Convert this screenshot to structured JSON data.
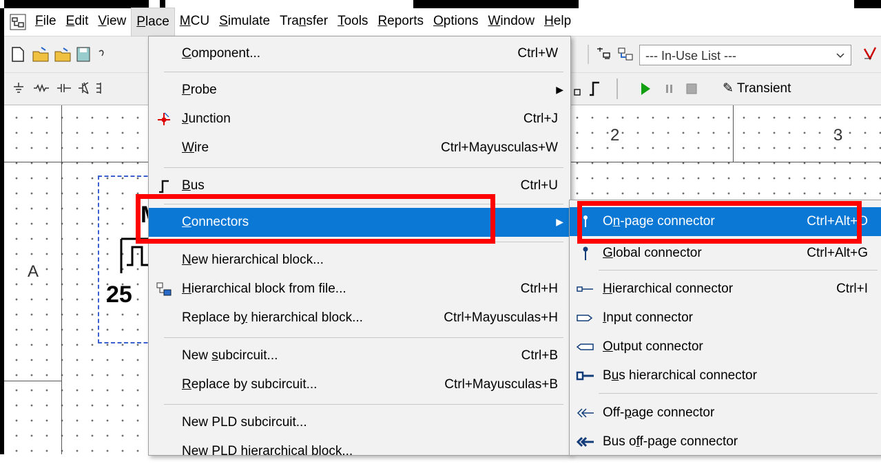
{
  "menubar": {
    "items": [
      {
        "id": "file",
        "text": "File",
        "mn": "F",
        "rest": "ile"
      },
      {
        "id": "edit",
        "text": "Edit",
        "mn": "E",
        "rest": "dit"
      },
      {
        "id": "view",
        "text": "View",
        "mn": "V",
        "rest": "iew"
      },
      {
        "id": "place",
        "text": "Place",
        "mn": "P",
        "rest": "lace",
        "active": true
      },
      {
        "id": "mcu",
        "text": "MCU",
        "mn": "M",
        "rest": "CU"
      },
      {
        "id": "simulate",
        "text": "Simulate",
        "mn": "S",
        "rest": "imulate"
      },
      {
        "id": "transfer",
        "text": "Transfer",
        "pre": "Tra",
        "mn": "n",
        "rest": "sfer"
      },
      {
        "id": "tools",
        "text": "Tools",
        "mn": "T",
        "rest": "ools"
      },
      {
        "id": "reports",
        "text": "Reports",
        "mn": "R",
        "rest": "eports"
      },
      {
        "id": "options",
        "text": "Options",
        "mn": "O",
        "rest": "ptions"
      },
      {
        "id": "window",
        "text": "Window",
        "mn": "W",
        "rest": "indow"
      },
      {
        "id": "help",
        "text": "Help",
        "mn": "H",
        "rest": "elp"
      }
    ]
  },
  "toolbar": {
    "inuse_list": "--- In-Use List ---",
    "transient": "Transient"
  },
  "canvas": {
    "col2": "2",
    "col3": "3",
    "rowA": "A",
    "partial_label_m": "M",
    "partial_value": "25"
  },
  "place_menu": {
    "component": {
      "pre": "",
      "mn": "C",
      "rest": "omponent...",
      "shortcut": "Ctrl+W"
    },
    "probe": {
      "pre": "",
      "mn": "P",
      "rest": "robe"
    },
    "junction": {
      "pre": "",
      "mn": "J",
      "rest": "unction",
      "shortcut": "Ctrl+J"
    },
    "wire": {
      "pre": "",
      "mn": "W",
      "rest": "ire",
      "shortcut": "Ctrl+Mayusculas+W"
    },
    "bus": {
      "pre": "",
      "mn": "B",
      "rest": "us",
      "shortcut": "Ctrl+U"
    },
    "connectors": {
      "pre": "",
      "mn": "C",
      "rest": "onnectors"
    },
    "new_hier_block": {
      "pre": "",
      "mn": "N",
      "rest": "ew hierarchical block..."
    },
    "hier_from_file": {
      "pre": "",
      "mn": "H",
      "rest": "ierarchical block from file...",
      "shortcut": "Ctrl+H"
    },
    "replace_hier": {
      "pre": "Replace b",
      "mn": "y",
      "rest": " hierarchical block...",
      "shortcut": "Ctrl+Mayusculas+H"
    },
    "new_subcircuit": {
      "pre": "New ",
      "mn": "s",
      "rest": "ubcircuit...",
      "shortcut": "Ctrl+B"
    },
    "replace_sub": {
      "pre": "",
      "mn": "R",
      "rest": "eplace by subcircuit...",
      "shortcut": "Ctrl+Mayusculas+B"
    },
    "new_pld_sub": {
      "pre": "New PLD subcircuit...",
      "mn": "",
      "rest": ""
    },
    "new_pld_hier": {
      "pre": "New PLD hierarchical block...",
      "mn": "",
      "rest": ""
    }
  },
  "connectors_menu": {
    "on_page": {
      "pre": "O",
      "mn": "n",
      "rest": "-page connector",
      "shortcut": "Ctrl+Alt+O"
    },
    "global": {
      "pre": "",
      "mn": "G",
      "rest": "lobal connector",
      "shortcut": "Ctrl+Alt+G"
    },
    "hierarchical": {
      "pre": "",
      "mn": "H",
      "rest": "ierarchical connector",
      "shortcut": "Ctrl+I"
    },
    "input": {
      "pre": "",
      "mn": "I",
      "rest": "nput connector"
    },
    "output": {
      "pre": "",
      "mn": "O",
      "rest": "utput connector"
    },
    "bus_hier": {
      "pre": "B",
      "mn": "u",
      "rest": "s hierarchical connector"
    },
    "off_page": {
      "pre": "Off-",
      "mn": "p",
      "rest": "age connector"
    },
    "bus_off_page": {
      "pre": "Bus o",
      "mn": "f",
      "rest": "f-page connector"
    }
  }
}
